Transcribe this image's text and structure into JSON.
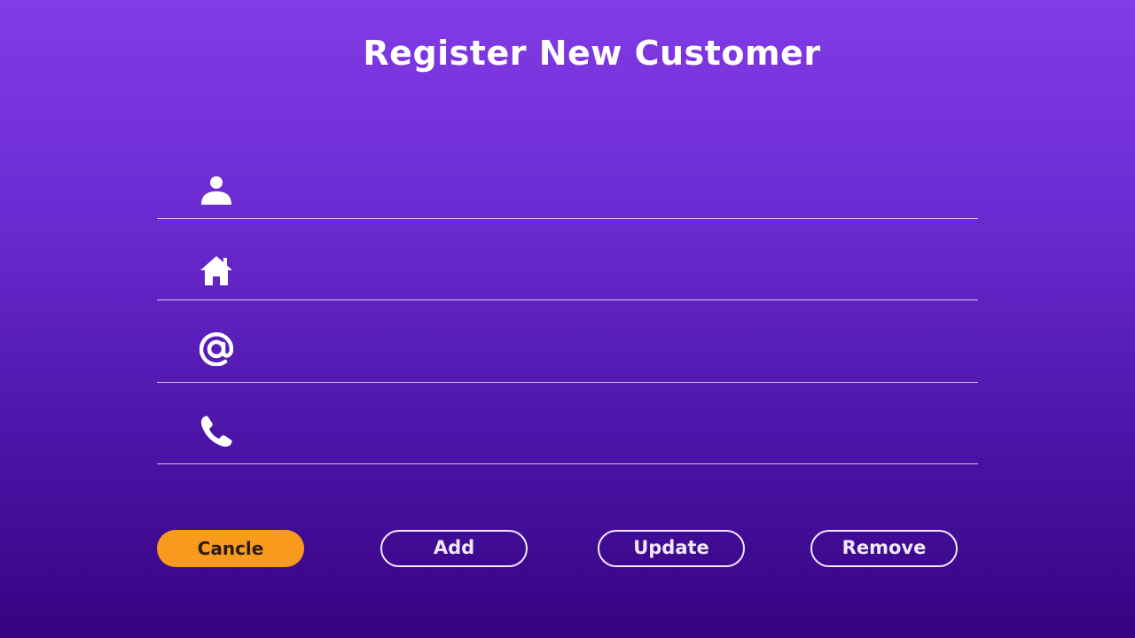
{
  "title": "Register New Customer",
  "fields": [
    {
      "icon": "person-icon",
      "value": "",
      "placeholder": ""
    },
    {
      "icon": "home-icon",
      "value": "",
      "placeholder": ""
    },
    {
      "icon": "at-sign-icon",
      "value": "",
      "placeholder": ""
    },
    {
      "icon": "phone-icon",
      "value": "",
      "placeholder": ""
    }
  ],
  "buttons": {
    "cancel": "Cancle",
    "add": "Add",
    "update": "Update",
    "remove": "Remove"
  },
  "colors": {
    "background_top": "#833be6",
    "background_bottom": "#360381",
    "cancel_button": "#f79a1e",
    "outline": "#f2e8ff"
  }
}
